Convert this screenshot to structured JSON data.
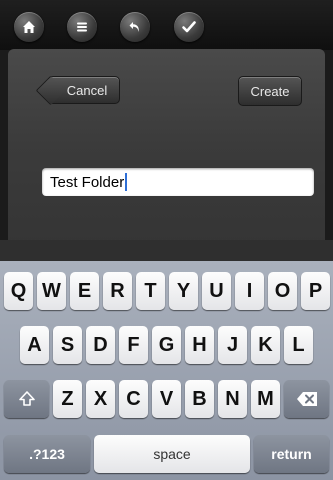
{
  "toolbar": {
    "icons": [
      "home-icon",
      "menu-icon",
      "undo-icon",
      "checkmark-icon"
    ]
  },
  "dialog": {
    "cancel_label": "Cancel",
    "create_label": "Create",
    "name_value": "Test Folder"
  },
  "keyboard": {
    "row1": [
      "Q",
      "W",
      "E",
      "R",
      "T",
      "Y",
      "U",
      "I",
      "O",
      "P"
    ],
    "row2": [
      "A",
      "S",
      "D",
      "F",
      "G",
      "H",
      "J",
      "K",
      "L"
    ],
    "row3": [
      "Z",
      "X",
      "C",
      "V",
      "B",
      "N",
      "M"
    ],
    "numbers_label": ".?123",
    "space_label": "space",
    "return_label": "return"
  }
}
